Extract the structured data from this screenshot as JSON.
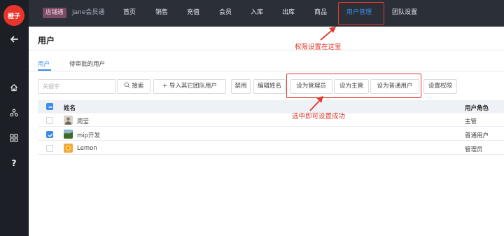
{
  "sidebar": {
    "logo_text": "橙子",
    "icons": [
      "back-arrow-icon",
      "home-icon",
      "branch-icon",
      "apps-grid-icon",
      "help-icon"
    ],
    "help_label": "?"
  },
  "topbar": {
    "store_badge": "店铺通",
    "store_name": "Jane会员通",
    "nav": [
      {
        "label": "首页"
      },
      {
        "label": "销售"
      },
      {
        "label": "充值"
      },
      {
        "label": "会员"
      },
      {
        "label": "入库"
      },
      {
        "label": "出库"
      },
      {
        "label": "商品"
      },
      {
        "label": "用户管理",
        "active": true
      },
      {
        "label": "团队设置"
      }
    ]
  },
  "page": {
    "title": "用户"
  },
  "tabs": [
    {
      "label": "用户",
      "active": true
    },
    {
      "label": "待审批的用户"
    }
  ],
  "toolbar": {
    "search_placeholder": "关键字",
    "search_button": "搜索",
    "import_button": "导入其它团队用户",
    "disable_button": "禁用",
    "edit_name_button": "编辑姓名",
    "set_admin_button": "设为管理员",
    "set_supervisor_button": "设为主管",
    "set_normal_button": "设为普通用户",
    "set_permission_button": "设置权限"
  },
  "annotations": {
    "permission_note": "权限设置在这里",
    "select_note": "选中即可设置成功"
  },
  "table": {
    "columns": {
      "name": "姓名",
      "role": "用户角色"
    },
    "rows": [
      {
        "name": "周莹",
        "role": "主管",
        "checked": false
      },
      {
        "name": "mip开发",
        "role": "普通用户",
        "checked": true
      },
      {
        "name": "Lemon",
        "role": "管理员",
        "checked": false
      }
    ]
  },
  "colors": {
    "accent": "#3a8ee6",
    "annotation": "#e03a2e",
    "sidebar_bg": "#1c1f26",
    "topbar_bg": "#2b2f38",
    "logo": "#e8342a"
  }
}
